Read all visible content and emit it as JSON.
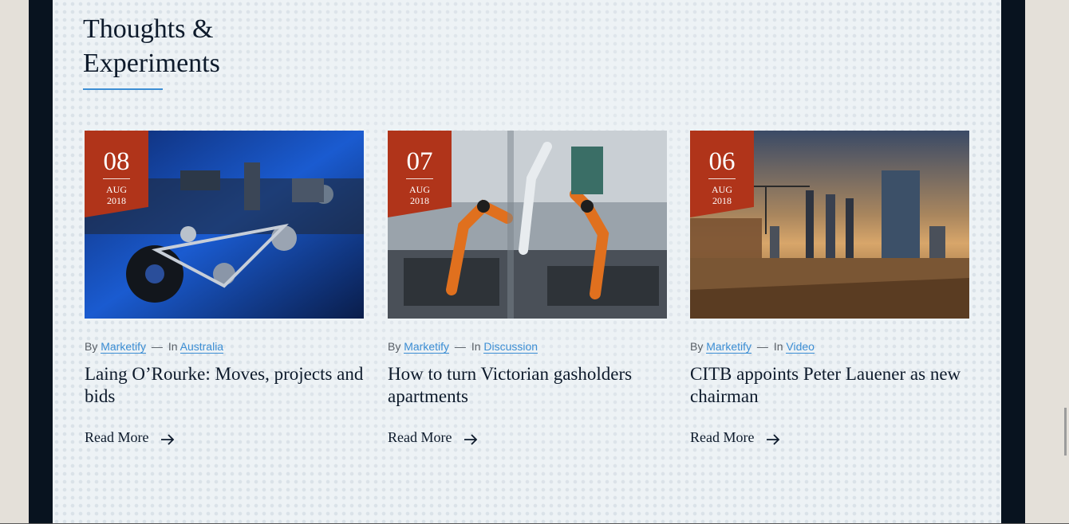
{
  "section": {
    "title_line1": "Thoughts &",
    "title_line2": "Experiments"
  },
  "colors": {
    "accent": "#3c8ed4",
    "badge": "#b0341a",
    "frame": "#08131f",
    "panel": "#edf2f5",
    "text": "#0d1a2b"
  },
  "posts": [
    {
      "day": "08",
      "month": "AUG",
      "year": "2018",
      "by_label": "By",
      "author": "Marketify",
      "in_label": "In",
      "category": "Australia",
      "title": "Laing O’Rourke: Moves, projects and bids",
      "read_more": "Read More",
      "image": "machinery-photo"
    },
    {
      "day": "07",
      "month": "AUG",
      "year": "2018",
      "by_label": "By",
      "author": "Marketify",
      "in_label": "In",
      "category": "Discussion",
      "title": "How to turn Victorian gasholders apartments",
      "read_more": "Read More",
      "image": "robot-arms-photo"
    },
    {
      "day": "06",
      "month": "AUG",
      "year": "2018",
      "by_label": "By",
      "author": "Marketify",
      "in_label": "In",
      "category": "Video",
      "title": "CITB appoints Peter Lauener as new chairman",
      "read_more": "Read More",
      "image": "city-construction-photo"
    }
  ],
  "separator": "—",
  "icons": {
    "read_more": "arrow-right-icon"
  }
}
